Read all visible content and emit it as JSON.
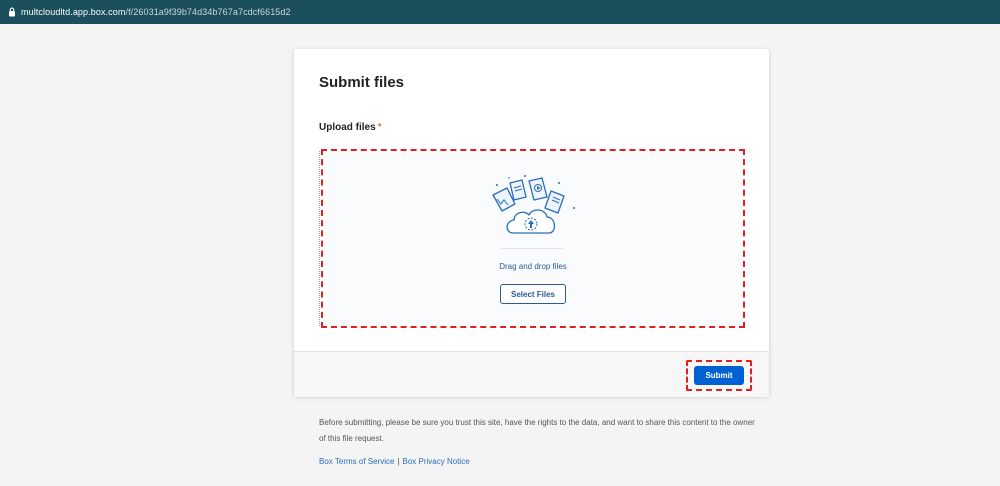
{
  "browser": {
    "url_domain": "multcloudltd.app.box.com",
    "url_path": "/f/26031a9f39b74d34b767a7cdcf6615d2"
  },
  "form": {
    "title": "Submit files",
    "upload_label": "Upload files",
    "required_marker": "*",
    "dropzone_text": "Drag and drop files",
    "select_button": "Select Files",
    "submit_button": "Submit"
  },
  "footer": {
    "disclaimer": "Before submitting, please be sure you trust this site, have the rights to the data, and want to share this content to the owner of this file request.",
    "terms_link": "Box Terms of Service",
    "separator": "|",
    "privacy_link": "Box Privacy Notice"
  },
  "colors": {
    "url_bar": "#1b4f5c",
    "primary": "#0061d5",
    "link": "#2a6ebb",
    "highlight": "#e02020"
  },
  "icons": {
    "lock": "lock-icon",
    "upload_illustration": "cloud-upload-illustration"
  }
}
